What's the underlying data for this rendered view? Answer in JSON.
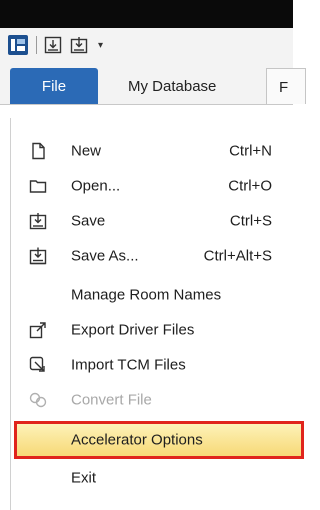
{
  "ribbon": {
    "tabs": [
      {
        "label": "File"
      },
      {
        "label": "My Database"
      },
      {
        "label": "F"
      }
    ]
  },
  "quick_access": {
    "icons": [
      "app-logo-icon",
      "save-icon",
      "save-as-icon",
      "customize-dropdown-icon"
    ],
    "dropdown_glyph": "▾"
  },
  "file_menu": {
    "items": [
      {
        "label": "New",
        "shortcut": "Ctrl+N",
        "icon": "new-document-icon"
      },
      {
        "label": "Open...",
        "shortcut": "Ctrl+O",
        "icon": "folder-icon"
      },
      {
        "label": "Save",
        "shortcut": "Ctrl+S",
        "icon": "save-icon"
      },
      {
        "label": "Save As...",
        "shortcut": "Ctrl+Alt+S",
        "icon": "save-as-icon"
      },
      {
        "label": "Manage Room Names",
        "shortcut": "",
        "icon": ""
      },
      {
        "label": "Export Driver Files",
        "shortcut": "",
        "icon": "export-icon"
      },
      {
        "label": "Import TCM Files",
        "shortcut": "",
        "icon": "import-icon"
      },
      {
        "label": "Convert File",
        "shortcut": "",
        "icon": "convert-icon",
        "disabled": true
      },
      {
        "label": "Accelerator Options",
        "shortcut": "",
        "icon": "",
        "highlighted": true
      },
      {
        "label": "Exit",
        "shortcut": "",
        "icon": ""
      }
    ]
  },
  "colors": {
    "file_tab": "#2b6ab6",
    "highlight_border": "#e0241c",
    "highlight_fill": "#f7d977"
  }
}
